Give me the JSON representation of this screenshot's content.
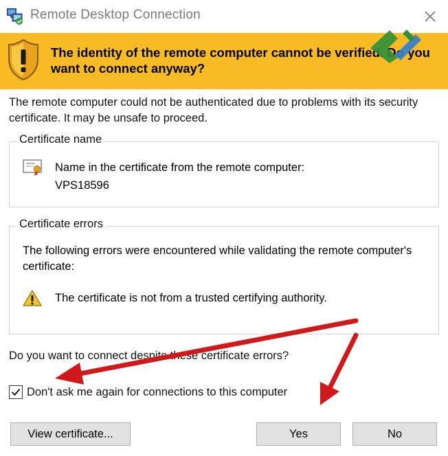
{
  "window": {
    "title": "Remote Desktop Connection",
    "icons": {
      "app": "remote-desktop-icon",
      "close": "close-icon"
    }
  },
  "banner": {
    "text": "The identity of the remote computer cannot be verified. Do you want to connect anyway?",
    "background_color": "#f9bb23",
    "icon": "shield-warning-icon"
  },
  "intro": "The remote computer could not be authenticated due to problems with its security certificate. It may be unsafe to proceed.",
  "certificate_name": {
    "title": "Certificate name",
    "label": "Name in the certificate from the remote computer:",
    "value": "VPS18596",
    "icon": "certificate-icon"
  },
  "certificate_errors": {
    "title": "Certificate errors",
    "description": "The following errors were encountered while validating the remote computer's certificate:",
    "error": "The certificate is not from a trusted certifying authority.",
    "icon": "warning-icon"
  },
  "question": "Do you want to connect despite these certificate errors?",
  "dont_ask": {
    "label": "Don't ask me again for connections to this computer",
    "checked": true
  },
  "buttons": {
    "view_certificate": "View certificate...",
    "yes": "Yes",
    "no": "No"
  },
  "annotation_color": "#d0191b"
}
